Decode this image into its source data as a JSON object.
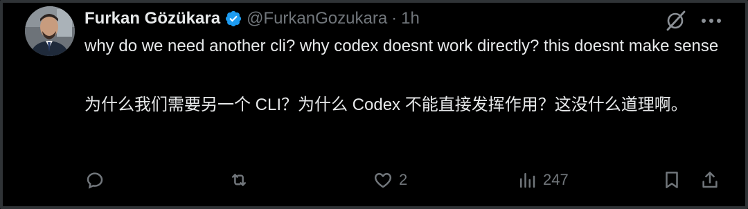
{
  "tweet": {
    "author_name": "Furkan Gözükara",
    "handle": "@FurkanGozukara",
    "separator": "·",
    "time": "1h",
    "text_en": "why do we need another cli? why codex doesnt work directly? this doesnt make sense",
    "text_zh": "为什么我们需要另一个 CLI？为什么 Codex 不能直接发挥作用？这没什么道理啊。"
  },
  "actions": {
    "reply_count": "",
    "repost_count": "",
    "like_count": "2",
    "views_count": "247"
  },
  "colors": {
    "background": "#000000",
    "text": "#e7e9ea",
    "muted": "#71767b",
    "verified": "#1d9bf0"
  },
  "icons": [
    "verified-badge-icon",
    "grok-icon",
    "more-icon",
    "reply-icon",
    "repost-icon",
    "like-icon",
    "views-icon",
    "bookmark-icon",
    "share-icon"
  ]
}
